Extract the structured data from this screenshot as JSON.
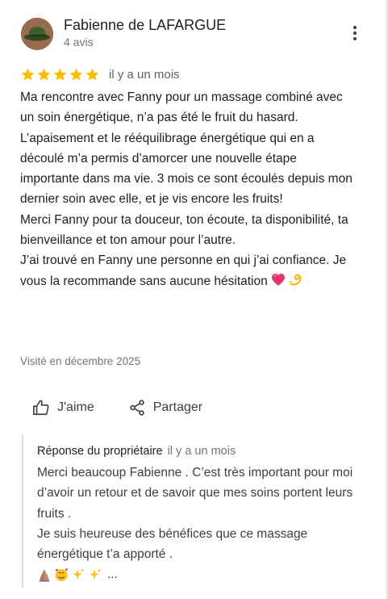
{
  "reviewer": {
    "name": "Fabienne de LAFARGUE",
    "review_count": "4 avis"
  },
  "review": {
    "rating": 5,
    "rating_max": 5,
    "time": "il y a un mois",
    "paragraphs": [
      "Ma rencontre avec Fanny pour un massage combiné avec un soin énergétique, n’a pas été le fruit du hasard. L’apaisement et le rééquilibrage énergétique qui en a découlé m’a permis d’amorcer une nouvelle étape importante dans ma vie. 3 mois ce sont écoulés depuis mon dernier soin avec elle, et je vis encore les fruits!",
      "Merci Fanny pour ta douceur, ton écoute, ta disponibilité, ta bienveillance et ton amour pour l’autre.",
      "J’ai trouvé en Fanny une personne en qui j’ai confiance. Je vous la recommande sans aucune hésitation"
    ],
    "visited": "Visité en décembre 2025"
  },
  "actions": {
    "like_label": "J'aime",
    "share_label": "Partager"
  },
  "owner_reply": {
    "label": "Réponse du propriétaire",
    "time": "il y a un mois",
    "paragraphs": [
      "Merci beaucoup Fabienne . C’est très important pour moi d’avoir un retour et de savoir que mes soins  portent  leurs fruits .",
      "Je suis heureuse des bénéfices que ce massage énergétique t’a apporté ."
    ],
    "truncation": "..."
  },
  "icons": {
    "avatar": "green-hat-avatar",
    "more": "more-vert-icon",
    "star": "star-icon",
    "like": "thumb-up-icon",
    "share": "share-icon",
    "review_emojis": [
      "heart-emoji",
      "dizzy-emoji"
    ],
    "reply_emojis": [
      "praying-hands-emoji",
      "smiling-face-with-hearts-emoji",
      "sparkles-emoji",
      "sparkles-emoji"
    ]
  },
  "colors": {
    "star": "#fbbc04",
    "text": "#202124",
    "secondary": "#70757a",
    "reply_border": "#dadce0"
  }
}
